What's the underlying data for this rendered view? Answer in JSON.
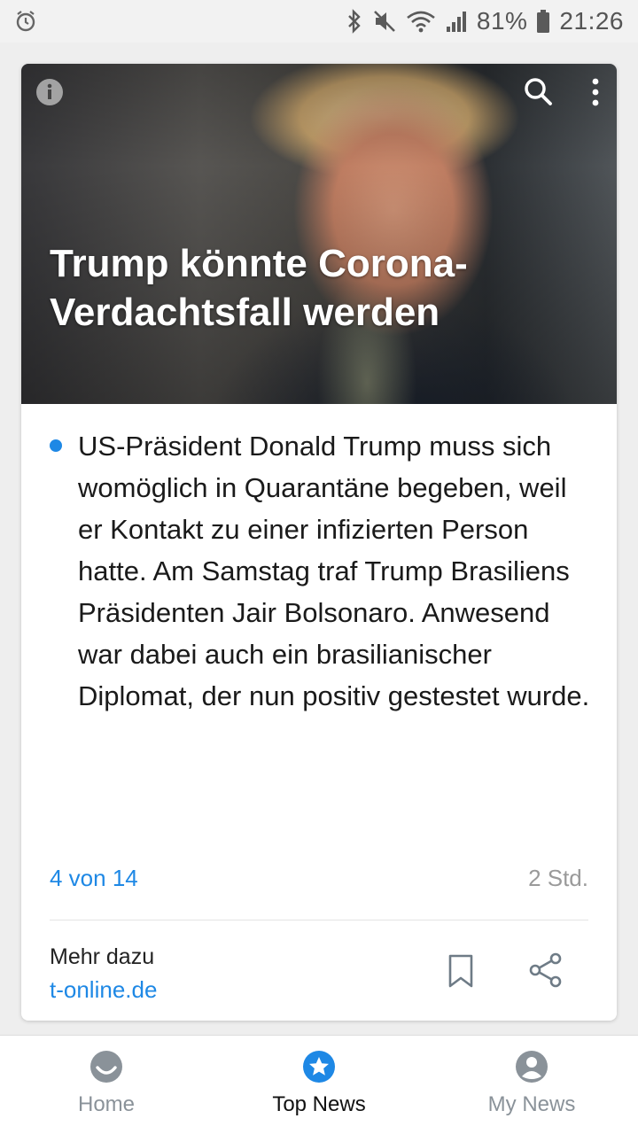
{
  "status_bar": {
    "battery_percent": "81%",
    "time": "21:26"
  },
  "article": {
    "headline": "Trump könnte Corona-Verdachtsfall werden",
    "summary": "US-Präsident Donald Trump muss sich womöglich in Quarantäne begeben, weil er Kontakt zu einer infizierten Person hatte. Am Samstag traf Trump Brasiliens Präsidenten Jair Bolsonaro. Anwesend war dabei auch ein brasilianischer Diplomat, der nun positiv gestestet wurde.",
    "counter": "4 von 14",
    "age": "2 Std.",
    "more_label": "Mehr dazu",
    "source": "t-online.de"
  },
  "bottom_nav": {
    "items": [
      {
        "label": "Home",
        "icon": "smiley-icon",
        "active": false
      },
      {
        "label": "Top News",
        "icon": "star-icon",
        "active": true
      },
      {
        "label": "My News",
        "icon": "account-icon",
        "active": false
      }
    ]
  },
  "colors": {
    "accent": "#1e88e5",
    "inactive_nav": "#8a9299",
    "muted_text": "#9a9a9a"
  }
}
